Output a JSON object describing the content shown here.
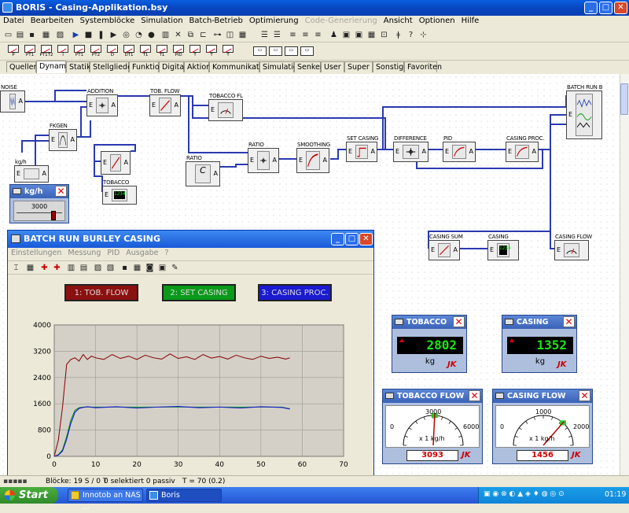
{
  "window": {
    "title": "BORIS - Casing-Applikation.bsy"
  },
  "menu": [
    "Datei",
    "Bearbeiten",
    "Systemblöcke",
    "Simulation",
    "Batch-Betrieb",
    "Optimierung",
    "Code-Generierung",
    "Ansicht",
    "Optionen",
    "Hilfe"
  ],
  "menu_disabled": "Code-Generierung",
  "block_palette": {
    "labels": [
      "P",
      "PT1",
      "PT1T2",
      "I",
      "PT1",
      "PT2",
      "D",
      "DT1",
      "T1",
      "T1",
      "PID",
      "T",
      "T",
      "T"
    ]
  },
  "tabs": [
    "Quellen",
    "Dynamik",
    "Statik",
    "Stellglieder",
    "Funktion",
    "Digital",
    "Aktion",
    "Kommunikation",
    "Simulation",
    "Senken",
    "User",
    "Super",
    "Sonstige",
    "Favoriten"
  ],
  "active_tab": "Dynamik",
  "blocks": {
    "noise": "NOISE",
    "addition": "ADDITION",
    "tob_flow": "TOB. FLOW",
    "tobacco_fl": "TOBACCO FL",
    "fkgen": "FKGEN",
    "kg_h": "kg/h",
    "tobacco": "TOBACCO",
    "ratio_sum": "RATIO",
    "ratio_const": "RATIO",
    "smoothing": "SMOOTHING",
    "set_casing": "SET CASING",
    "difference": "DIFFERENCE",
    "pid": "PID",
    "casing_proc": "CASING PROC.",
    "batch_run": "BATCH RUN B",
    "casing_sum": "CASING SUM",
    "casing": "CASING",
    "casing_flow": "CASING FLOW",
    "tobacco_lcd": "1234"
  },
  "kgh_widget": {
    "title": "kg/h",
    "value": "3000",
    "level": 0.82
  },
  "tobacco_display": {
    "title": "TOBACCO",
    "value": "2802",
    "unit": "kg",
    "logo": "JK"
  },
  "casing_display": {
    "title": "CASING",
    "value": "1352",
    "unit": "kg",
    "logo": "JK"
  },
  "tobacco_flow_gauge": {
    "title": "TOBACCO FLOW",
    "min": "0",
    "mid": "3000",
    "max": "6000",
    "unit": "x 1 kg/h",
    "value": "3093",
    "needle": 3093,
    "range_max": 6000,
    "logo": "JK"
  },
  "casing_flow_gauge": {
    "title": "CASING FLOW",
    "min": "0",
    "mid": "1000",
    "max": "2000",
    "unit": "x 1 kg/h",
    "value": "1456",
    "needle": 1456,
    "range_max": 2000,
    "logo": "JK"
  },
  "batch_window": {
    "title": "BATCH RUN BURLEY CASING",
    "menu": [
      "Einstellungen",
      "Messung",
      "PID",
      "Ausgabe",
      "?"
    ],
    "legend": [
      {
        "label": "1: TOB. FLOW",
        "color": "#8b1010"
      },
      {
        "label": "2: SET CASING",
        "color": "#0a9a1a"
      },
      {
        "label": "3: CASING PROC.",
        "color": "#1a1ad0"
      }
    ]
  },
  "chart_data": {
    "type": "line",
    "title": "",
    "xlabel": "",
    "ylabel": "",
    "xlim": [
      0,
      70
    ],
    "ylim": [
      0,
      4000
    ],
    "xticks": [
      "0",
      "10",
      "20",
      "30",
      "40",
      "50",
      "60",
      "70"
    ],
    "yticks": [
      "0",
      "800",
      "1600",
      "2400",
      "3200",
      "4000"
    ],
    "grid": true,
    "series": [
      {
        "name": "1: TOB. FLOW",
        "color": "#8b1010",
        "x": [
          0,
          1,
          2,
          3,
          4,
          5,
          6,
          7,
          8,
          9,
          10,
          12,
          14,
          16,
          18,
          20,
          22,
          24,
          26,
          28,
          30,
          32,
          34,
          36,
          38,
          40,
          42,
          44,
          46,
          48,
          50,
          52,
          54,
          56,
          57
        ],
        "y": [
          0,
          500,
          1500,
          2800,
          2950,
          3000,
          2900,
          3100,
          2950,
          3050,
          3000,
          2950,
          3100,
          2980,
          3050,
          2950,
          3080,
          3000,
          2960,
          3120,
          2980,
          3030,
          2950,
          3100,
          2990,
          3040,
          2960,
          3080,
          3000,
          2950,
          3050,
          2980,
          3020,
          2960,
          3000
        ]
      },
      {
        "name": "2: SET CASING",
        "color": "#0a9a1a",
        "x": [
          0,
          1,
          2,
          3,
          4,
          5,
          6,
          7,
          8,
          10,
          15,
          20,
          25,
          30,
          35,
          40,
          45,
          50,
          55,
          57
        ],
        "y": [
          0,
          50,
          200,
          600,
          1100,
          1400,
          1480,
          1500,
          1500,
          1500,
          1500,
          1500,
          1500,
          1500,
          1500,
          1500,
          1500,
          1500,
          1500,
          1450
        ]
      },
      {
        "name": "3: CASING PROC.",
        "color": "#1a1ad0",
        "x": [
          0,
          1,
          2,
          3,
          4,
          5,
          6,
          7,
          8,
          10,
          15,
          20,
          25,
          30,
          35,
          40,
          45,
          50,
          55,
          57
        ],
        "y": [
          0,
          40,
          160,
          520,
          1000,
          1340,
          1460,
          1490,
          1510,
          1480,
          1510,
          1470,
          1500,
          1520,
          1480,
          1500,
          1470,
          1510,
          1490,
          1440
        ]
      }
    ]
  },
  "status": {
    "blocks": "Blöcke: 19 S / 0 T",
    "selected": "0 selektiert 0 passiv",
    "time": "T = 70 (0.2)"
  },
  "taskbar": {
    "start": "Start",
    "tasks": [
      "Innotob an NAS ...",
      "Boris"
    ],
    "clock": "01:19"
  }
}
